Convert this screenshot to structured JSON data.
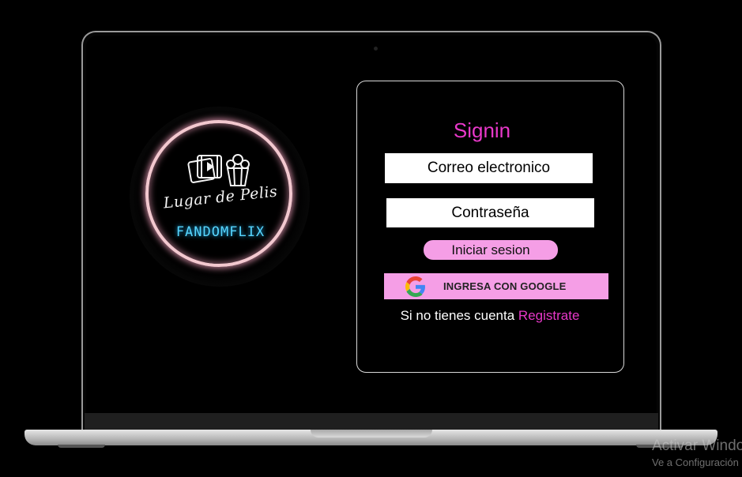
{
  "logo": {
    "script_text": "Lugar de Pelis",
    "brand_text": "FANDOMFLIX"
  },
  "signin": {
    "title": "Signin",
    "email_placeholder": "Correo electronico",
    "password_placeholder": "Contraseña",
    "login_label": "Iniciar sesion",
    "google_label": "INGRESA CON GOOGLE",
    "register_prompt": "Si no tienes cuenta",
    "register_link": "Registrate"
  },
  "watermark": {
    "title": "Activar Windows",
    "subtitle": "Ve a Configuración"
  },
  "colors": {
    "accent_pink": "#e838c9",
    "button_pink": "#f59ee6",
    "neon_cyan": "#57d6ff",
    "ring_pink": "#f3c8cf"
  },
  "icons": [
    "film-icon",
    "popcorn-icon",
    "google-icon",
    "camera-icon"
  ]
}
